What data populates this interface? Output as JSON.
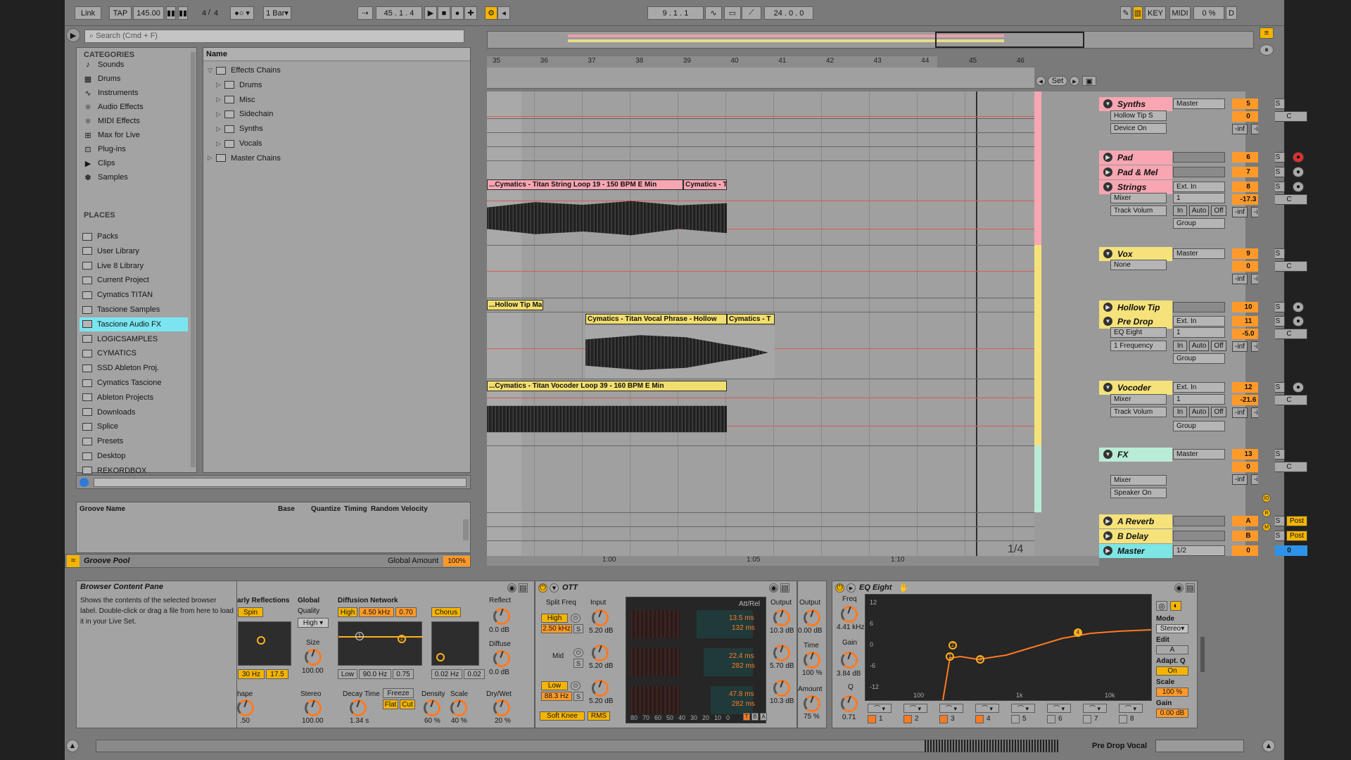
{
  "transport": {
    "link": "Link",
    "tap": "TAP",
    "tempo": "145.00",
    "time_sig_num": "4",
    "time_sig_den": "4",
    "quant": "1 Bar",
    "position": "45 . 1 . 4",
    "loop_start": "9 . 1 . 1",
    "loop_len": "24 . 0 . 0",
    "key": "KEY",
    "midi": "MIDI",
    "cpu": "0 %",
    "d": "D"
  },
  "browser": {
    "search_placeholder": "Search (Cmd + F)",
    "categories_title": "CATEGORIES",
    "categories": [
      "Sounds",
      "Drums",
      "Instruments",
      "Audio Effects",
      "MIDI Effects",
      "Max for Live",
      "Plug-ins",
      "Clips",
      "Samples"
    ],
    "places_title": "PLACES",
    "places": [
      "Packs",
      "User Library",
      "Live 8 Library",
      "Current Project",
      "Cymatics TITAN",
      "Tascione Samples",
      "Tascione Audio FX",
      "LOGICSAMPLES",
      "CYMATICS",
      "SSD Ableton Proj.",
      "Cymatics Tascione",
      "Ableton Projects",
      "Downloads",
      "Splice",
      "Presets",
      "Desktop",
      "REKORDBOX"
    ],
    "name_header": "Name",
    "tree": [
      {
        "label": "Effects Chains",
        "level": 0,
        "open": true
      },
      {
        "label": "Drums",
        "level": 1
      },
      {
        "label": "Misc",
        "level": 1
      },
      {
        "label": "Sidechain",
        "level": 1
      },
      {
        "label": "Synths",
        "level": 1
      },
      {
        "label": "Vocals",
        "level": 1
      },
      {
        "label": "Master Chains",
        "level": 0
      }
    ]
  },
  "groove": {
    "cols": [
      "Groove Name",
      "Base",
      "Quantize",
      "Timing",
      "Random",
      "Velocity"
    ],
    "pool_label": "Groove Pool",
    "global_label": "Global Amount",
    "global_value": "100%"
  },
  "info": {
    "title": "Browser Content Pane",
    "text": "Shows the contents of the selected browser label. Double-click or drag a file from here to load it in your Live Set."
  },
  "ruler": [
    "35",
    "36",
    "37",
    "38",
    "39",
    "40",
    "41",
    "42",
    "43",
    "44",
    "45",
    "46"
  ],
  "bottom_ruler": [
    "1:00",
    "1:05",
    "1:10"
  ],
  "zoom": "1/4",
  "clips": {
    "string1": "...Cymatics - Titan String Loop 19 - 150 BPM E Min",
    "string2": "Cymatics - T",
    "hollow": "...Hollow Tip Ma",
    "vocal1": "Cymatics - Titan Vocal Phrase - Hollow",
    "vocal2": "Cymatics - T",
    "vocoder": "...Cymatics - Titan Vocoder Loop 39 - 160 BPM E Min"
  },
  "set_label": "Set",
  "tracks": [
    {
      "name": "Synths",
      "color": "#f7a6b2",
      "out": "Master",
      "num": "5",
      "vol": "0"
    },
    {
      "name": "Pad",
      "color": "#f7a6b2",
      "num": "6"
    },
    {
      "name": "Pad & Mel",
      "color": "#f7a6b2",
      "num": "7"
    },
    {
      "name": "Strings",
      "color": "#f7a6b2",
      "in": "Ext. In",
      "num": "8",
      "vol": "-17.3"
    },
    {
      "name": "Vox",
      "color": "#f5e27a",
      "out": "Master",
      "num": "9",
      "vol": "0"
    },
    {
      "name": "Hollow Tip",
      "color": "#f5e27a",
      "num": "10"
    },
    {
      "name": "Pre Drop",
      "color": "#f5e27a",
      "in": "Ext. In",
      "num": "11",
      "vol": "-5.0"
    },
    {
      "name": "Vocoder",
      "color": "#f5e27a",
      "in": "Ext. In",
      "num": "12",
      "vol": "-21.6"
    },
    {
      "name": "FX",
      "color": "#b9ecd6",
      "out": "Master",
      "num": "13",
      "vol": "0"
    },
    {
      "name": "A Reverb",
      "color": "#f5e27a",
      "num": "A"
    },
    {
      "name": "B Delay",
      "color": "#f5e27a",
      "num": "B"
    },
    {
      "name": "Master",
      "color": "#7ee5e5",
      "num": "0",
      "route": "1/2"
    }
  ],
  "mixer": {
    "hollow_tip_s": "Hollow Tip S",
    "device_on": "Device On",
    "mixer": "Mixer",
    "track_volume": "Track Volum",
    "none": "None",
    "eq_eight": "EQ Eight",
    "one_freq": "1 Frequency",
    "speaker_on": "Speaker On",
    "group": "Group",
    "one": "1",
    "in": "In",
    "auto": "Auto",
    "off": "Off",
    "inf": "-inf",
    "c": "C",
    "s": "S",
    "post": "Post"
  },
  "reverb": {
    "early": "arly Reflections",
    "spin": "Spin",
    "global": "Global",
    "quality": "Quality",
    "quality_val": "High",
    "diffusion": "Diffusion Network",
    "high": "High",
    "high_freq": "4.50 kHz",
    "high_val": "0.70",
    "chorus": "Chorus",
    "reflect": "Reflect",
    "reflect_val": "0.0 dB",
    "diffuse": "Diffuse",
    "diffuse_val": "0.0 dB",
    "size": "Size",
    "size_val": "100.00",
    "hz30": "30 Hz",
    "r175": "17.5",
    "low": "Low",
    "low_freq": "90.0 Hz",
    "low_val": "0.75",
    "hz002": "0.02 Hz",
    "v002": "0.02",
    "shape": "hape",
    "shape_val": ".50",
    "stereo": "Stereo",
    "stereo_val": "100.00",
    "decay": "Decay Time",
    "decay_val": "1.34 s",
    "freeze": "Freeze",
    "flat": "Flat",
    "cut": "Cut",
    "density": "Density",
    "density_val": "60 %",
    "scale": "Scale",
    "scale_val": "40 %",
    "drywet": "Dry/Wet",
    "drywet_val": "20 %"
  },
  "ott": {
    "title": "OTT",
    "split": "Split Freq",
    "input": "Input",
    "high": "High",
    "high_freq": "2.50 kHz",
    "in_high": "5.20 dB",
    "mid": "Mid",
    "in_mid": "5.20 dB",
    "low": "Low",
    "low_freq": "88.3 Hz",
    "in_low": "5.20 dB",
    "soft_knee": "Soft Knee",
    "rms": "RMS",
    "att_rel": "Att/Rel",
    "t1a": "13.5 ms",
    "t1b": "132 ms",
    "t2a": "22.4 ms",
    "t2b": "282 ms",
    "t3a": "47.8 ms",
    "t3b": "282 ms",
    "scale": [
      "80",
      "70",
      "60",
      "50",
      "40",
      "30",
      "20",
      "10",
      "0"
    ],
    "output": "Output",
    "out_high": "10.3 dB",
    "out_mid": "5.70 dB",
    "out_low": "10.3 dB",
    "output2": "Output",
    "out2_val": "0.00 dB",
    "time": "Time",
    "time_val": "100 %",
    "amount": "Amount",
    "amount_val": "75 %"
  },
  "eq": {
    "title": "EQ Eight",
    "freq": "Freq",
    "freq_val": "4.41 kHz",
    "gain": "Gain",
    "gain_val": "3.84 dB",
    "q": "Q",
    "q_val": "0.71",
    "y_labels": [
      "12",
      "6",
      "0",
      "-6",
      "-12"
    ],
    "x_labels": [
      "100",
      "1k",
      "10k"
    ],
    "mode": "Mode",
    "mode_val": "Stereo",
    "edit": "Edit",
    "edit_val": "A",
    "adapt": "Adapt. Q",
    "adapt_val": "On",
    "scale": "Scale",
    "scale_val": "100 %",
    "gain2": "Gain",
    "gain2_val": "0.00 dB",
    "bands": [
      "1",
      "2",
      "3",
      "4",
      "5",
      "6",
      "7",
      "8"
    ]
  },
  "status": {
    "clip_name": "Pre Drop Vocal"
  }
}
